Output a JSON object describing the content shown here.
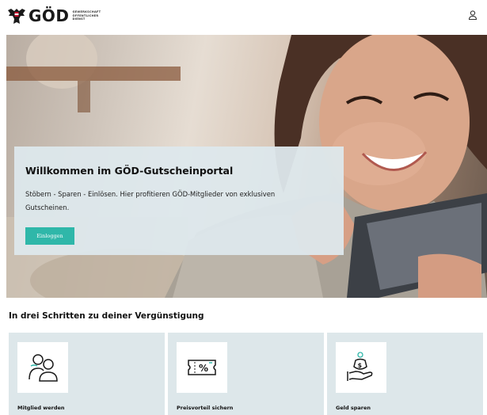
{
  "header": {
    "logo_text": "GÖD",
    "logo_sub": [
      "GEWERKSCHAFT",
      "ÖFFENTLICHER",
      "DIENST"
    ],
    "user_icon": "user-icon"
  },
  "hero": {
    "title": "Willkommen im GÖD-Gutscheinportal",
    "text": "Stöbern - Sparen - Einlösen. Hier profitieren GÖD-Mitglieder von exklusiven Gutscheinen.",
    "login_label": "Einloggen",
    "accent_color": "#2fb7a9"
  },
  "steps": {
    "title": "In drei Schritten zu deiner Vergünstigung",
    "items": [
      {
        "label": "Mitglied werden",
        "icon": "users-icon"
      },
      {
        "label": "Preisvorteil sichern",
        "icon": "voucher-icon"
      },
      {
        "label": "Geld sparen",
        "icon": "money-hand-icon"
      }
    ]
  }
}
